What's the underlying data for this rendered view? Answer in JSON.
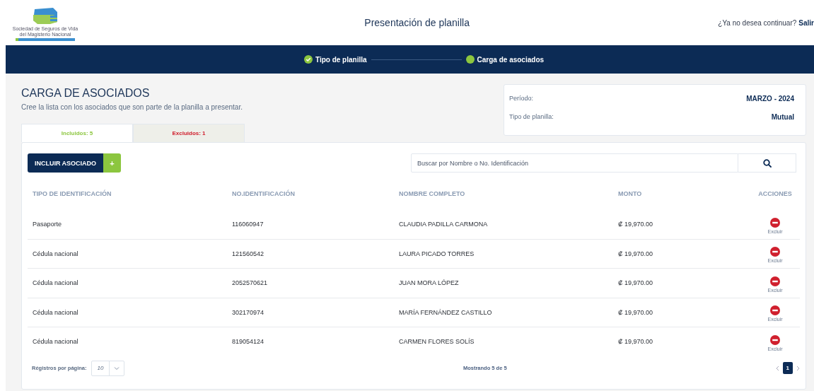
{
  "header": {
    "logo_lines": [
      "Sociedad de Seguros de Vida",
      "del Magisterio Nacional"
    ],
    "title": "Presentación de planilla",
    "exit_prompt": "¿Ya no desea continuar?",
    "exit_link": "Salir"
  },
  "steps": [
    {
      "label": "Tipo de planilla",
      "done": true
    },
    {
      "label": "Carga de asociados",
      "done": false
    }
  ],
  "section": {
    "title": "CARGA DE ASOCIADOS",
    "subtitle": "Cree la lista con los asociados que son parte de la planilla a presentar."
  },
  "summary": [
    {
      "label": "Período:",
      "value": "MARZO - 2024"
    },
    {
      "label": "Tipo de planilla:",
      "value": "Mutual"
    }
  ],
  "tabs": [
    {
      "label": "Incluidos: 5",
      "selected": true,
      "color": "#8cc63f"
    },
    {
      "label": "Excluidos: 1",
      "selected": false,
      "color": "#d0202e"
    }
  ],
  "add_button": {
    "label": "INCLUIR ASOCIADO",
    "icon": "+"
  },
  "search": {
    "placeholder": "Buscar por Nombre o No. Identificación"
  },
  "table": {
    "columns": [
      "TIPO DE IDENTIFICACIÓN",
      "NO.IDENTIFICACIÓN",
      "NOMBRE COMPLETO",
      "MONTO",
      "ACCIONES"
    ],
    "rows": [
      {
        "id_type": "Pasaporte",
        "id_number": "116060947",
        "name": "CLAUDIA PADILLA CARMONA",
        "amount": "₡ 19,970.00",
        "action": "Excluir"
      },
      {
        "id_type": "Cédula nacional",
        "id_number": "121560542",
        "name": "LAURA PICADO TORRES",
        "amount": "₡ 19,970.00",
        "action": "Excluir"
      },
      {
        "id_type": "Cédula nacional",
        "id_number": "2052570621",
        "name": "JUAN MORA LÓPEZ",
        "amount": "₡ 19,970.00",
        "action": "Excluir"
      },
      {
        "id_type": "Cédula nacional",
        "id_number": "302170974",
        "name": "MARÍA FERNÁNDEZ CASTILLO",
        "amount": "₡ 19,970.00",
        "action": "Excluir"
      },
      {
        "id_type": "Cédula nacional",
        "id_number": "819054124",
        "name": "CARMEN FLORES SOLÍS",
        "amount": "₡ 19,970.00",
        "action": "Excluir"
      }
    ]
  },
  "footer": {
    "per_page_label": "Régistros por página:",
    "per_page_value": "10",
    "showing": "Mostrando 5 de 5",
    "pages": [
      {
        "label": "1",
        "selected": true
      }
    ]
  }
}
